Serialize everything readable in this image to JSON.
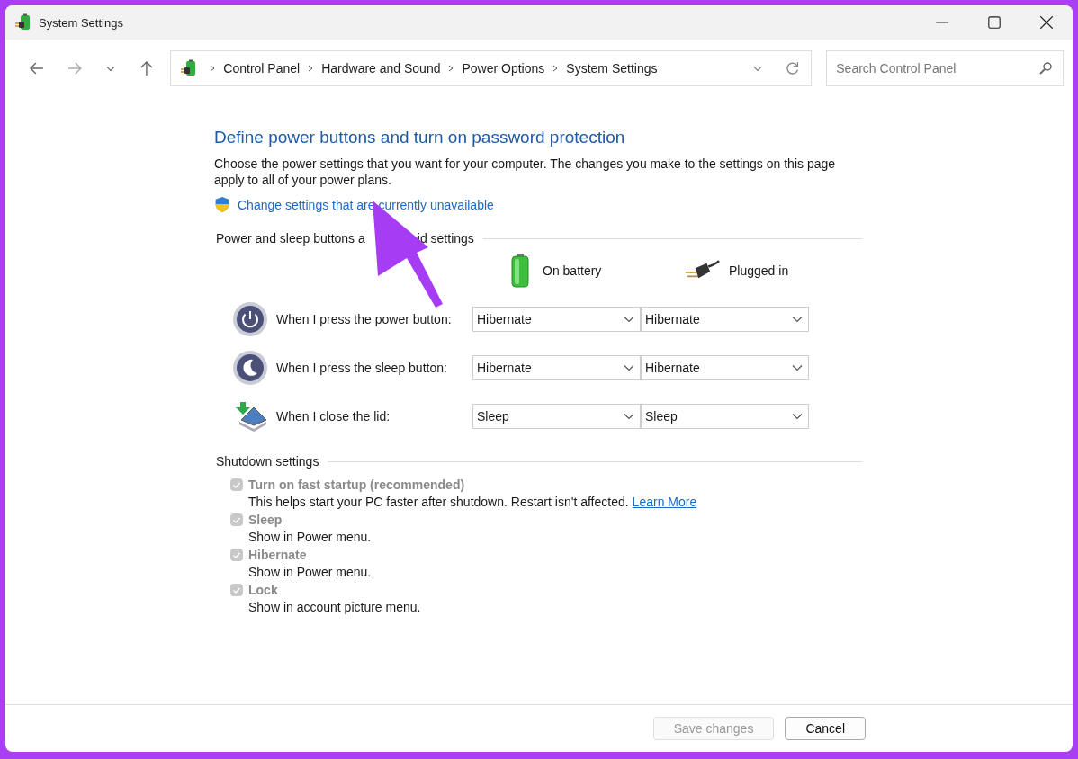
{
  "window": {
    "title": "System Settings"
  },
  "address_bar": {
    "crumbs": [
      "Control Panel",
      "Hardware and Sound",
      "Power Options",
      "System Settings"
    ]
  },
  "search": {
    "placeholder": "Search Control Panel"
  },
  "heading": "Define power buttons and turn on password protection",
  "description": "Choose the power settings that you want for your computer. The changes you make to the settings on this page apply to all of your power plans.",
  "admin_link": "Change settings that are currently unavailable",
  "power_section": {
    "title_parts": [
      "Power and sleep buttons a",
      "id settings"
    ],
    "columns": [
      {
        "kind": "battery",
        "label": "On battery"
      },
      {
        "kind": "plug",
        "label": "Plugged in"
      }
    ],
    "rows": [
      {
        "kind": "power",
        "label": "When I press the power button:",
        "values": [
          "Hibernate",
          "Hibernate"
        ]
      },
      {
        "kind": "sleep",
        "label": "When I press the sleep button:",
        "values": [
          "Hibernate",
          "Hibernate"
        ]
      },
      {
        "kind": "lid",
        "label": "When I close the lid:",
        "values": [
          "Sleep",
          "Sleep"
        ]
      }
    ]
  },
  "shutdown_section": {
    "title": "Shutdown settings",
    "items": [
      {
        "label": "Turn on fast startup (recommended)",
        "checked": true,
        "disabled": true,
        "description": "This helps start your PC faster after shutdown. Restart isn't affected.",
        "link": "Learn More"
      },
      {
        "label": "Sleep",
        "checked": true,
        "disabled": true,
        "description": "Show in Power menu."
      },
      {
        "label": "Hibernate",
        "checked": true,
        "disabled": true,
        "description": "Show in Power menu."
      },
      {
        "label": "Lock",
        "checked": true,
        "disabled": true,
        "description": "Show in account picture menu."
      }
    ]
  },
  "buttons": [
    {
      "label": "Save changes",
      "disabled": true
    },
    {
      "label": "Cancel",
      "disabled": false
    }
  ]
}
